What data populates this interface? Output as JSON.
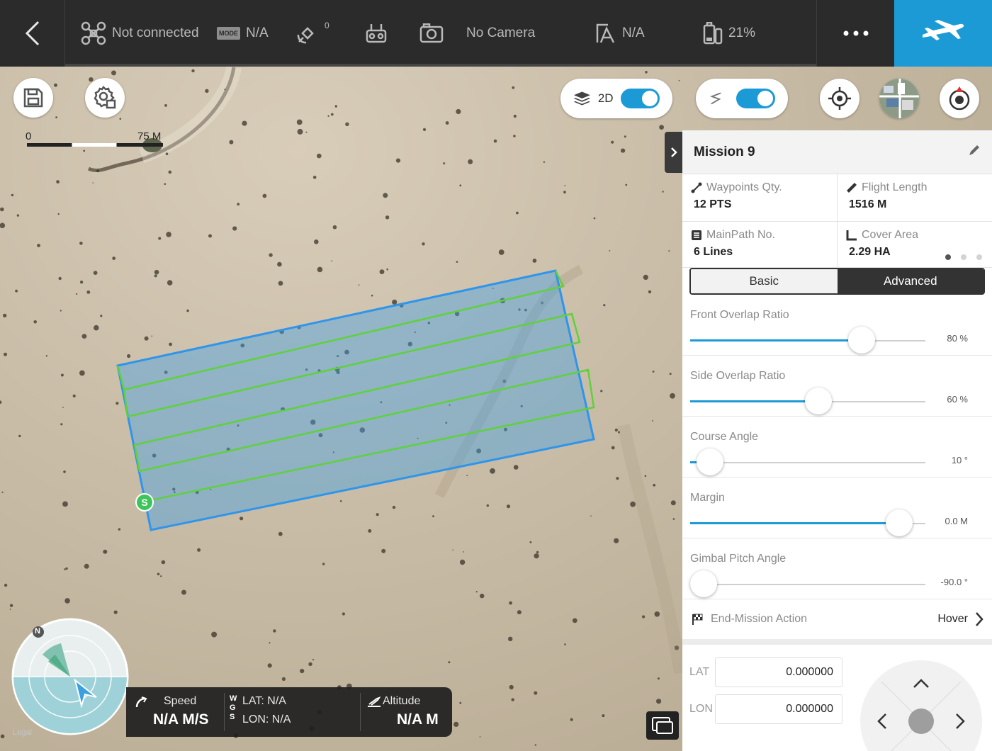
{
  "topbar": {
    "connection": "Not connected",
    "mode_badge": "MODE",
    "mode_value": "N/A",
    "satellites": "0",
    "camera": "No Camera",
    "flight_mode": "N/A",
    "battery": "21%"
  },
  "map": {
    "toggle_2d_label": "2D",
    "scale_start": "0",
    "scale_end": "75 M",
    "start_marker": "S",
    "compass_north": "N",
    "legal": "Legal"
  },
  "telemetry": {
    "speed_label": "Speed",
    "speed_value": "N/A M/S",
    "wgs_letters": [
      "W",
      "G",
      "S"
    ],
    "lat": "LAT: N/A",
    "lon": "LON: N/A",
    "altitude_label": "Altitude",
    "altitude_value": "N/A M"
  },
  "panel": {
    "title": "Mission 9",
    "stats": [
      {
        "label": "Waypoints Qty.",
        "value": "12 PTS",
        "icon": "route-icon"
      },
      {
        "label": "Flight Length",
        "value": "1516 M",
        "icon": "ruler-icon"
      },
      {
        "label": "MainPath No.",
        "value": "6 Lines",
        "icon": "lines-icon"
      },
      {
        "label": "Cover Area",
        "value": "2.29 HA",
        "icon": "area-icon"
      }
    ],
    "tabs": {
      "basic": "Basic",
      "advanced": "Advanced",
      "active": "Advanced"
    },
    "sliders": [
      {
        "label": "Front Overlap Ratio",
        "value": "80 %",
        "fraction": 0.76
      },
      {
        "label": "Side Overlap Ratio",
        "value": "60 %",
        "fraction": 0.55
      },
      {
        "label": "Course Angle",
        "value": "10 °",
        "fraction": 0.03
      },
      {
        "label": "Margin",
        "value": "0.0 M",
        "fraction": 0.94
      },
      {
        "label": "Gimbal Pitch Angle",
        "value": "-90.0 °",
        "fraction": 0.0
      }
    ],
    "end_action_label": "End-Mission Action",
    "end_action_value": "Hover",
    "lat_label": "LAT",
    "lat_value": "0.000000",
    "lon_label": "LON",
    "lon_value": "0.000000"
  },
  "colors": {
    "accent": "#1c9ad6",
    "topbar": "#2b2b2b",
    "flight_path": "#5fd13b",
    "survey_area": "#3ea0e6"
  }
}
